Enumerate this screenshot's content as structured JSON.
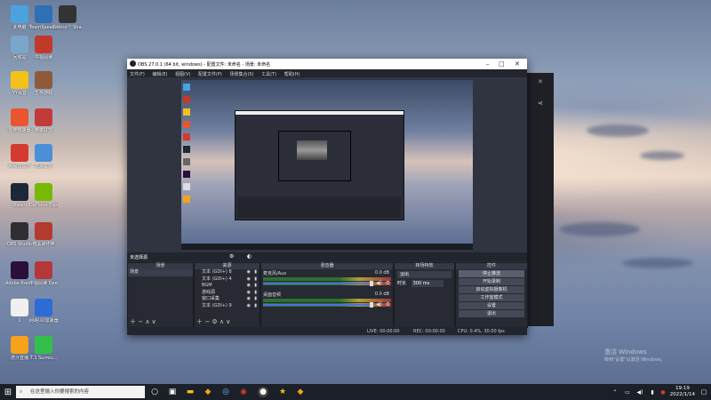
{
  "desktop": {
    "icons": [
      {
        "label": "此电脑",
        "icon": "computer-icon",
        "color": "#4aa3df"
      },
      {
        "label": "TeamSpeak 3",
        "icon": "teamspeak-icon",
        "color": "#2f6fb3"
      },
      {
        "label": "Sekiro™ Shadow...",
        "icon": "sekiro-icon",
        "color": "#333"
      },
      {
        "label": "回收站",
        "icon": "recycle-bin-icon",
        "color": "#7aa6c9"
      },
      {
        "label": "中视阅读",
        "icon": "app-icon",
        "color": "#c0392b"
      },
      {
        "label": "YY语音",
        "icon": "yy-icon",
        "color": "#f2c21b"
      },
      {
        "label": "生存游戏",
        "icon": "game-icon",
        "color": "#8e5a3a"
      },
      {
        "label": "雷神加速器",
        "icon": "leishen-icon",
        "color": "#e8552e"
      },
      {
        "label": "英雄联盟",
        "icon": "lol-icon",
        "color": "#c23b3b"
      },
      {
        "label": "网易云音乐",
        "icon": "netease-music-icon",
        "color": "#d33a31"
      },
      {
        "label": "酷狗音乐",
        "icon": "kugou-icon",
        "color": "#4a8fd8"
      },
      {
        "label": "Steam",
        "icon": "steam-icon",
        "color": "#1b2838"
      },
      {
        "label": "GeForce Experience",
        "icon": "nvidia-icon",
        "color": "#76b900"
      },
      {
        "label": "OBS Studio",
        "icon": "obs-icon",
        "color": "#302e31"
      },
      {
        "label": "暗黑破坏神",
        "icon": "app-icon",
        "color": "#b53a2e"
      },
      {
        "label": "Adobe Premiere",
        "icon": "premiere-icon",
        "color": "#2a0f3b"
      },
      {
        "label": "中视阅读 Demo",
        "icon": "app-icon",
        "color": "#b5373a"
      },
      {
        "label": "1",
        "icon": "file-icon",
        "color": "#f0f0f0"
      },
      {
        "label": "网易UU加速器",
        "icon": "uu-icon",
        "color": "#2d6cd6"
      },
      {
        "label": "虎牙直播",
        "icon": "huya-icon",
        "color": "#f7a21b"
      },
      {
        "label": "7.1 Surrou...",
        "icon": "surround-icon",
        "color": "#33c04a"
      }
    ]
  },
  "obs": {
    "title": "OBS 27.0.1 (64 bit, windows) - 配置文件: 未命名 - 场景: 未命名",
    "menu": [
      "文件(F)",
      "编辑(E)",
      "视图(V)",
      "配置文件(P)",
      "场景集合(S)",
      "工具(T)",
      "帮助(H)"
    ],
    "source_bar_label": "未选择源",
    "docks": {
      "scenes": {
        "title": "场景",
        "items": [
          "场景"
        ]
      },
      "sources": {
        "title": "来源",
        "items": [
          "文本 (GDI+) 8",
          "文本 (GDI+) 4",
          "BGM",
          "游戏源",
          "窗口采集",
          "文本 (GDI+) 9"
        ]
      },
      "mixer": {
        "title": "混音器",
        "tracks": [
          {
            "name": "麦克风/Aux",
            "db": "0.0 dB"
          },
          {
            "name": "桌面音频",
            "db": "0.0 dB"
          }
        ]
      },
      "transitions": {
        "title": "转场特效",
        "type": "淡出",
        "duration_label": "时长",
        "duration": "300 ms"
      },
      "controls": {
        "title": "控件",
        "buttons": [
          "停止推流",
          "开始录制",
          "启动虚拟摄像机",
          "工作室模式",
          "设置",
          "退出"
        ]
      }
    },
    "status": {
      "live": "LIVE: 00:00:00",
      "rec": "REC: 00:00:00",
      "cpu": "CPU: 0.4%, 30.00 fps"
    }
  },
  "taskbar": {
    "search_placeholder": "在这里输入你要搜索的内容",
    "time": "19:19",
    "date": "2022/1/14"
  },
  "watermark": {
    "line1": "激活 Windows",
    "line2": "转到\"设置\"以激活 Windows。"
  }
}
